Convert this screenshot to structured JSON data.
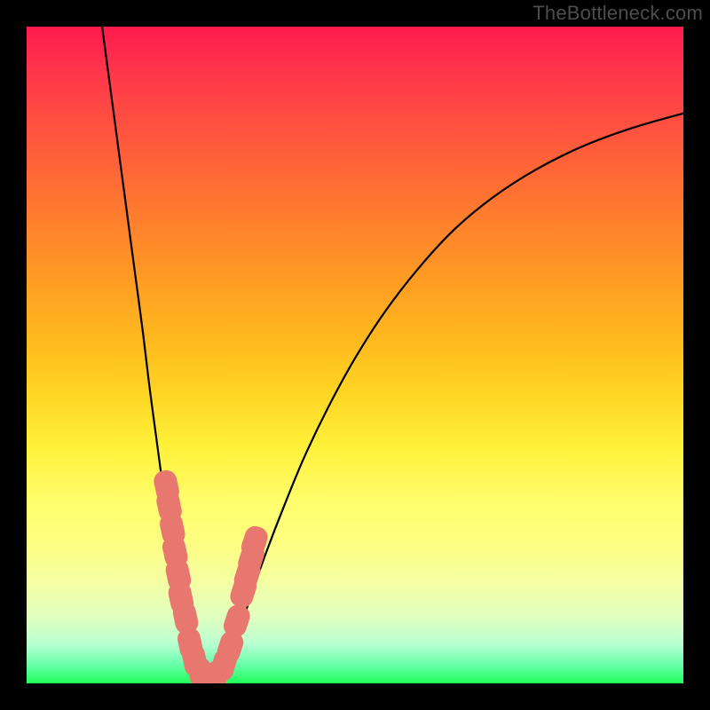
{
  "watermark": "TheBottleneck.com",
  "colors": {
    "frame": "#000000",
    "curve": "#000000",
    "marker_fill": "#e8786f",
    "marker_stroke": "#e8786f"
  },
  "chart_data": {
    "type": "line",
    "title": "",
    "xlabel": "",
    "ylabel": "",
    "xlim": [
      0,
      100
    ],
    "ylim": [
      0,
      100
    ],
    "grid": false,
    "legend": false,
    "series": [
      {
        "name": "left_arm",
        "values_xy": [
          [
            11.5,
            100.0
          ],
          [
            12.4,
            93.2
          ],
          [
            13.3,
            86.5
          ],
          [
            14.2,
            79.7
          ],
          [
            15.1,
            73.0
          ],
          [
            16.0,
            66.2
          ],
          [
            16.9,
            59.5
          ],
          [
            17.8,
            52.7
          ],
          [
            18.6,
            46.0
          ],
          [
            19.5,
            39.2
          ],
          [
            20.4,
            32.5
          ],
          [
            21.3,
            25.7
          ],
          [
            22.2,
            19.0
          ],
          [
            23.1,
            14.0
          ],
          [
            24.0,
            9.0
          ],
          [
            24.9,
            5.5
          ],
          [
            25.8,
            2.7
          ],
          [
            26.8,
            1.0
          ],
          [
            27.7,
            0.2
          ]
        ]
      },
      {
        "name": "right_arm",
        "values_xy": [
          [
            27.7,
            0.2
          ],
          [
            29.0,
            0.8
          ],
          [
            30.6,
            3.5
          ],
          [
            32.4,
            8.0
          ],
          [
            34.2,
            13.5
          ],
          [
            36.5,
            20.0
          ],
          [
            39.2,
            27.0
          ],
          [
            42.3,
            34.5
          ],
          [
            45.9,
            42.0
          ],
          [
            50.0,
            49.5
          ],
          [
            54.5,
            56.5
          ],
          [
            59.5,
            63.0
          ],
          [
            65.0,
            69.0
          ],
          [
            71.0,
            74.0
          ],
          [
            77.5,
            78.2
          ],
          [
            84.5,
            81.7
          ],
          [
            92.0,
            84.5
          ],
          [
            100.0,
            86.8
          ]
        ]
      }
    ],
    "markers": {
      "note": "Pink bead markers clustered near the V-shaped minimum",
      "shape": "rounded-square",
      "size": 6,
      "points_xy": [
        [
          21.3,
          30.0
        ],
        [
          21.7,
          27.0
        ],
        [
          22.2,
          23.5
        ],
        [
          22.6,
          20.0
        ],
        [
          23.1,
          16.5
        ],
        [
          23.5,
          13.0
        ],
        [
          24.2,
          10.0
        ],
        [
          24.9,
          6.0
        ],
        [
          25.6,
          3.5
        ],
        [
          26.5,
          1.5
        ],
        [
          27.7,
          0.5
        ],
        [
          28.8,
          1.0
        ],
        [
          30.0,
          2.8
        ],
        [
          31.0,
          5.5
        ],
        [
          32.0,
          9.5
        ],
        [
          33.0,
          14.0
        ],
        [
          33.6,
          16.5
        ],
        [
          34.2,
          19.0
        ],
        [
          34.7,
          21.5
        ]
      ]
    }
  }
}
